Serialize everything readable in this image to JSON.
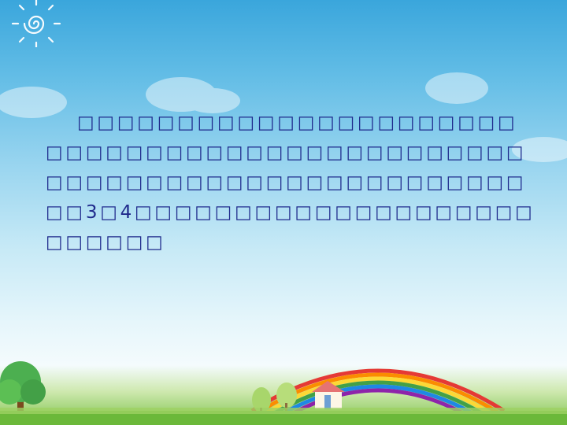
{
  "slide": {
    "body_text": "□□□□□□□□□□□□□□□□□□□□□□□□□□□□□□□□□□□□□□□□□□□□□□□□□□□□□□□□□□□□□□□□□□□□□□□□3□4□□□□□□□□□□□□□□□□□□□□□□□□□□"
  },
  "colors": {
    "text": "#1f2a8c",
    "sky_top": "#3aa6dc",
    "grass": "#7cc24a"
  },
  "icons": [
    "sun-spiral-icon",
    "rainbow-icon",
    "tree-icon",
    "house-icon"
  ]
}
